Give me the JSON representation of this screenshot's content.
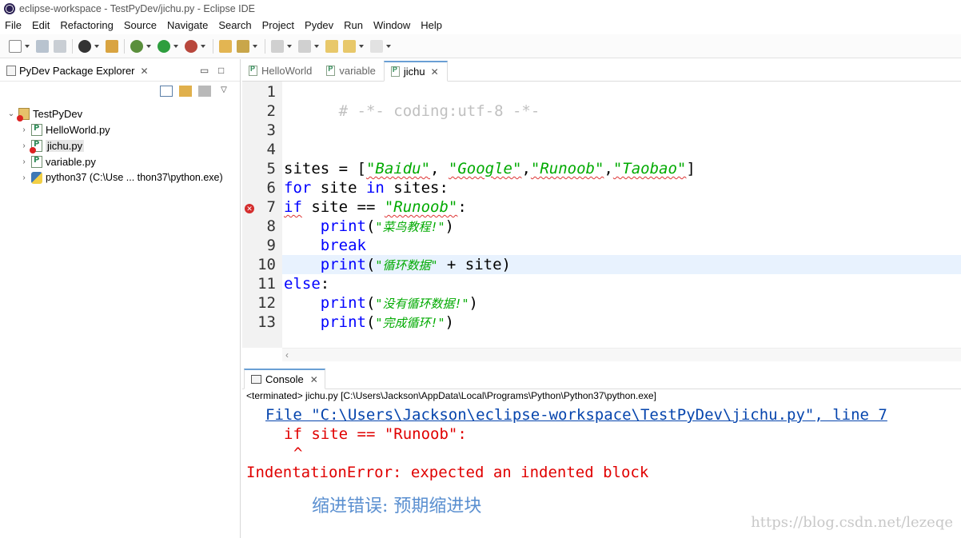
{
  "window": {
    "title": "eclipse-workspace - TestPyDev/jichu.py - Eclipse IDE"
  },
  "menubar": {
    "items": [
      "File",
      "Edit",
      "Refactoring",
      "Source",
      "Navigate",
      "Search",
      "Project",
      "Pydev",
      "Run",
      "Window",
      "Help"
    ]
  },
  "explorer": {
    "title": "PyDev Package Explorer",
    "project": "TestPyDev",
    "items": [
      {
        "label": "HelloWorld.py"
      },
      {
        "label": "jichu.py",
        "selected": true,
        "error": true
      },
      {
        "label": "variable.py"
      },
      {
        "label": "python37  (C:\\Use ... thon37\\python.exe)"
      }
    ]
  },
  "editor": {
    "tabs": [
      {
        "label": "HelloWorld",
        "active": false
      },
      {
        "label": "variable",
        "active": false
      },
      {
        "label": "jichu",
        "active": true
      }
    ],
    "line_numbers": [
      "1",
      "2",
      "3",
      "4",
      "5",
      "6",
      "7",
      "8",
      "9",
      "10",
      "11",
      "12",
      "13"
    ],
    "current_line": 10,
    "error_line": 7,
    "code": {
      "l1": "# -*- coding:utf-8 -*-",
      "l5_a": "sites = [",
      "l5_s1": "\"Baidu\"",
      "l5_b": ", ",
      "l5_s2": "\"Google\"",
      "l5_c": ",",
      "l5_s3": "\"Runoob\"",
      "l5_d": ",",
      "l5_s4": "\"Taobao\"",
      "l5_e": "]",
      "l6_kw1": "for",
      "l6_a": " site ",
      "l6_kw2": "in",
      "l6_b": " sites:",
      "l7_kw": "if",
      "l7_a": " site == ",
      "l7_s": "\"Runoob\"",
      "l7_b": ":",
      "l8_kw": "print",
      "l8_a": "(",
      "l8_s": "\"菜鸟教程!\"",
      "l8_b": ")",
      "l9_kw": "break",
      "l10_kw": "print",
      "l10_a": "(",
      "l10_s": "\"循环数据\"",
      "l10_b": " + site)",
      "l11_kw": "else",
      "l11_a": ":",
      "l12_kw": "print",
      "l12_a": "(",
      "l12_s": "\"没有循环数据!\"",
      "l12_b": ")",
      "l13_kw": "print",
      "l13_a": "(",
      "l13_s": "\"完成循环!\"",
      "l13_b": ")"
    }
  },
  "console": {
    "tab_label": "Console",
    "status": "<terminated> jichu.py [C:\\Users\\Jackson\\AppData\\Local\\Programs\\Python\\Python37\\python.exe]",
    "lines": {
      "file_link": "File \"C:\\Users\\Jackson\\eclipse-workspace\\TestPyDev\\jichu.py\", line 7",
      "code_echo": "if site == \"Runoob\":",
      "caret": "^",
      "error": "IndentationError: expected an indented block"
    },
    "annotation": "缩进错误: 预期缩进块",
    "watermark": "https://blog.csdn.net/lezeqe"
  },
  "colors": {
    "keyword": "#0000ff",
    "string": "#00aa00",
    "comment": "#c0c0c0",
    "error": "#e00000",
    "link": "#0645ad",
    "current_line_bg": "#e8f2fe"
  }
}
